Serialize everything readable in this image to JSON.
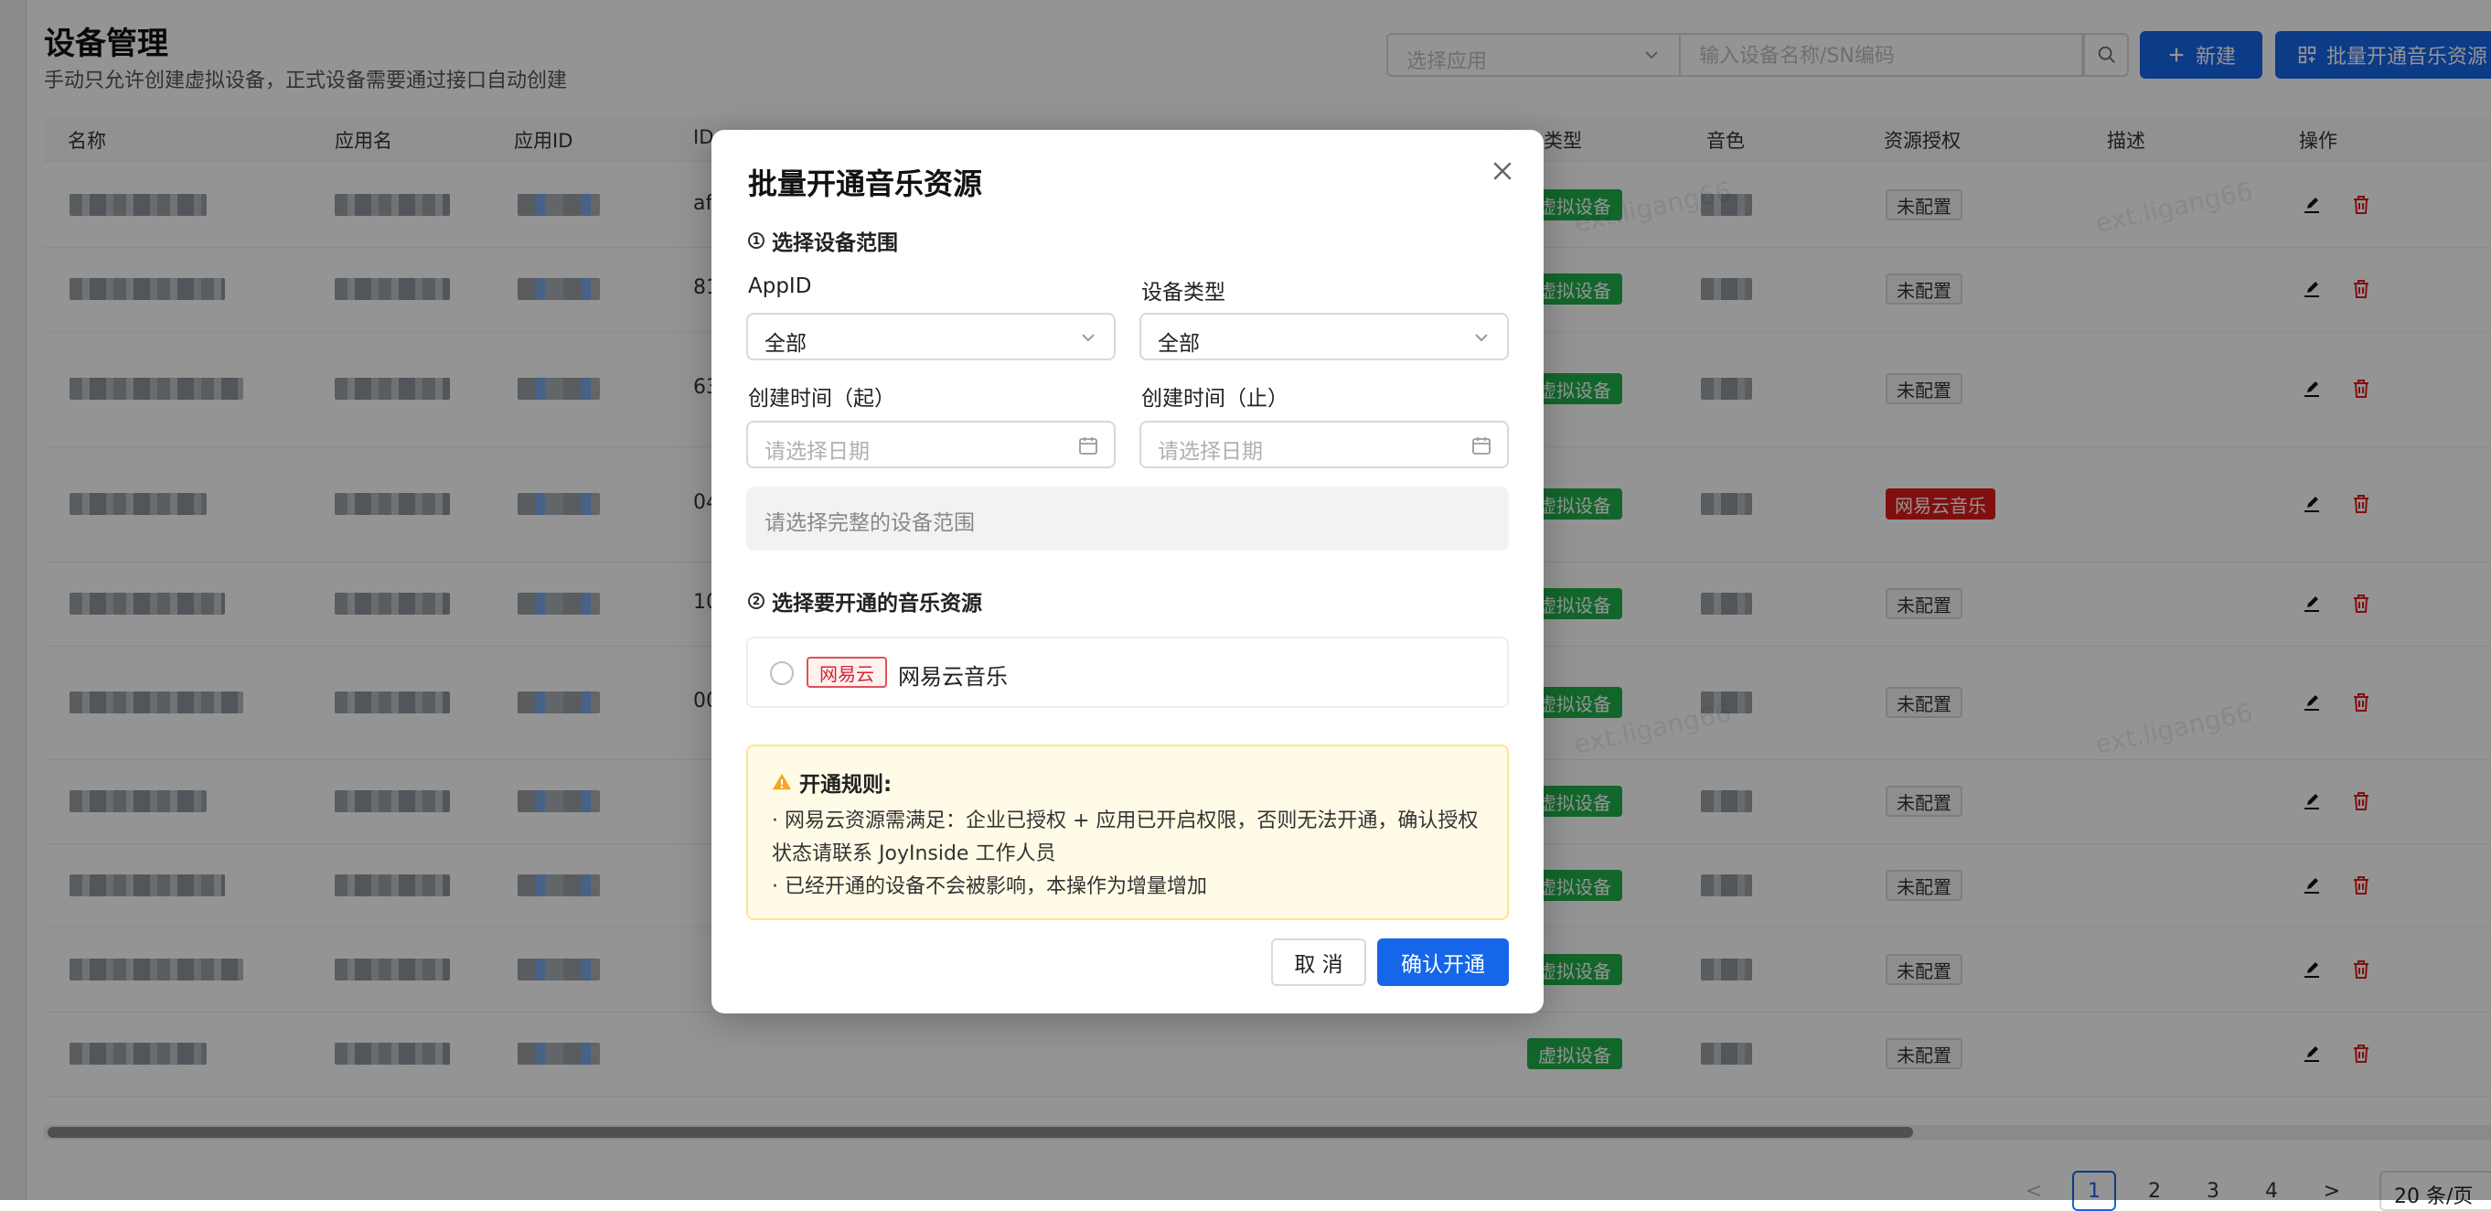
{
  "page": {
    "title": "设备管理",
    "subtitle": "手动只允许创建虚拟设备，正式设备需要通过接口自动创建"
  },
  "toolbar": {
    "app_select_placeholder": "选择应用",
    "search_placeholder": "输入设备名称/SN编码",
    "new_label": "新建",
    "batch_label": "批量开通音乐资源"
  },
  "table": {
    "columns": [
      "名称",
      "应用名",
      "应用ID",
      "ID",
      "类型",
      "音色",
      "资源授权",
      "描述",
      "操作"
    ],
    "type_tag": "虚拟设备",
    "auth_default": "未配置",
    "auth_special": "网易云音乐",
    "rows": [
      {
        "id_prefix": "af",
        "auth": "未配置",
        "voice": "",
        "appid_prefix": ""
      },
      {
        "id_prefix": "81",
        "auth": "未配置",
        "voice": "",
        "appid_prefix": ""
      },
      {
        "id_prefix": "63",
        "auth": "未配置",
        "voice": "",
        "appid_prefix": ""
      },
      {
        "id_prefix": "04",
        "auth": "网易云音乐",
        "voice": "",
        "appid_prefix": "1"
      },
      {
        "id_prefix": "10",
        "auth": "未配置",
        "voice": "",
        "appid_prefix": "1"
      },
      {
        "id_prefix": "00",
        "auth": "未配置",
        "voice": "",
        "appid_prefix": ""
      },
      {
        "id_prefix": "",
        "auth": "未配置",
        "voice": "二",
        "appid_prefix": ""
      },
      {
        "id_prefix": "",
        "auth": "未配置",
        "voice": "二司",
        "appid_prefix": ""
      },
      {
        "id_prefix": "",
        "auth": "未配置",
        "voice": "",
        "appid_prefix": ""
      },
      {
        "id_prefix": "",
        "auth": "未配置",
        "voice": "",
        "appid_prefix": ""
      }
    ]
  },
  "pagination": {
    "pages": [
      "1",
      "2",
      "3",
      "4"
    ],
    "active": "1",
    "page_size": "20 条/页",
    "prev": "<",
    "next": ">"
  },
  "watermark": "ext.ligang66",
  "modal": {
    "title": "批量开通音乐资源",
    "step1": {
      "num": "1",
      "title": "选择设备范围"
    },
    "appid_label": "AppID",
    "appid_value": "全部",
    "device_type_label": "设备类型",
    "device_type_value": "全部",
    "start_label": "创建时间（起）",
    "end_label": "创建时间（止）",
    "date_placeholder": "请选择日期",
    "range_hint": "请选择完整的设备范围",
    "step2": {
      "num": "2",
      "title": "选择要开通的音乐资源"
    },
    "resource": {
      "tag": "网易云",
      "name": "网易云音乐"
    },
    "rules": {
      "title": "开通规则:",
      "line1": "· 网易云资源需满足：企业已授权 + 应用已开启权限，否则无法开通，确认授权状态请联系 JoyInside 工作人员",
      "line2": "· 已经开通的设备不会被影响，本操作为增量增加"
    },
    "cancel": "取 消",
    "confirm": "确认开通"
  },
  "colors": {
    "primary": "#1566e8",
    "tag_green": "#21b04b",
    "tag_red": "#e01b1b",
    "warning_bg": "#fffbe6",
    "warning_border": "#ffe58f",
    "brand_red": "#d62433"
  }
}
